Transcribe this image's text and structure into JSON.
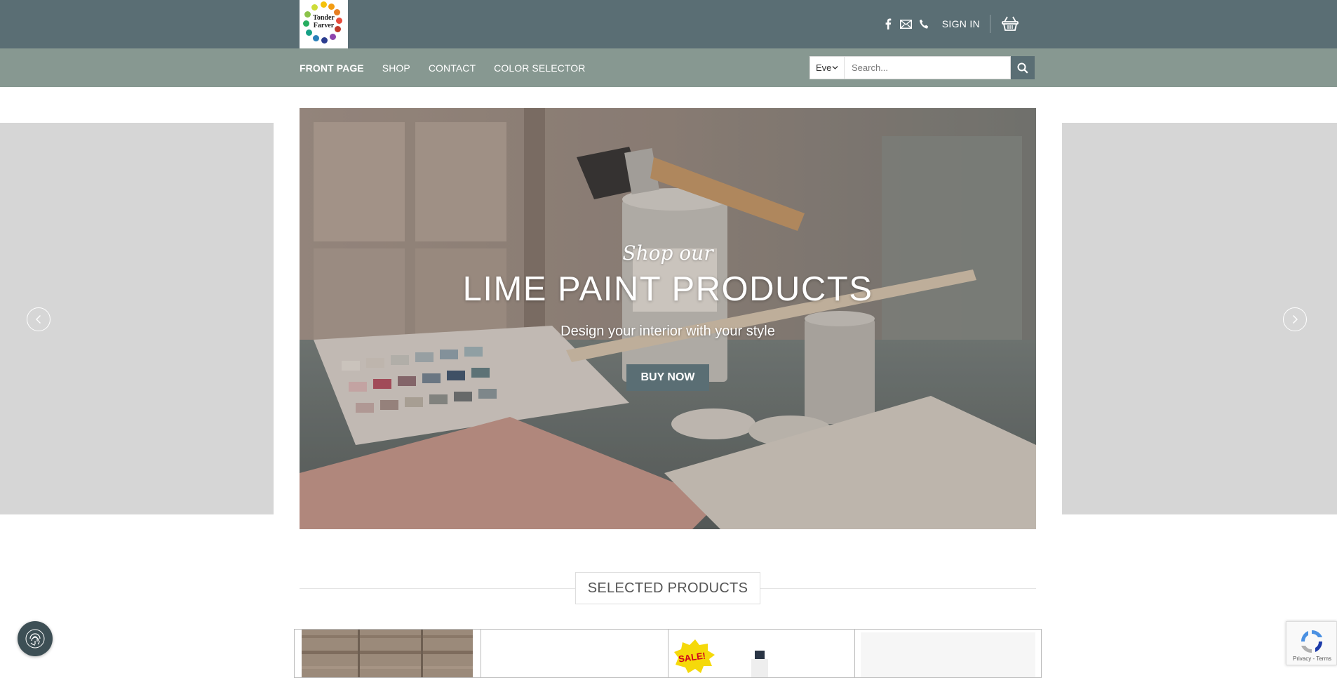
{
  "brand": {
    "logo_line1": "Tonder",
    "logo_line2": "Farver",
    "colors": {
      "topbar": "#5a6e74",
      "navbar": "#879891",
      "button": "#5a6e74"
    }
  },
  "header": {
    "icons": [
      "facebook-icon",
      "email-icon",
      "phone-icon"
    ],
    "signin_label": "SIGN IN",
    "cart_icon": "basket-icon"
  },
  "nav": {
    "items": [
      {
        "label": "FRONT PAGE"
      },
      {
        "label": "SHOP"
      },
      {
        "label": "CONTACT"
      },
      {
        "label": "COLOR SELECTOR"
      }
    ]
  },
  "search": {
    "category": "Eve",
    "placeholder": "Search..."
  },
  "hero": {
    "pretitle": "Shop our",
    "title": "LIME PAINT PRODUCTS",
    "subtitle": "Design your interior with your style",
    "button_label": "BUY NOW"
  },
  "section": {
    "title": "SELECTED PRODUCTS"
  },
  "products": {
    "sale_badge": "SALE!"
  },
  "recaptcha": {
    "label": "Privacy - Terms"
  }
}
